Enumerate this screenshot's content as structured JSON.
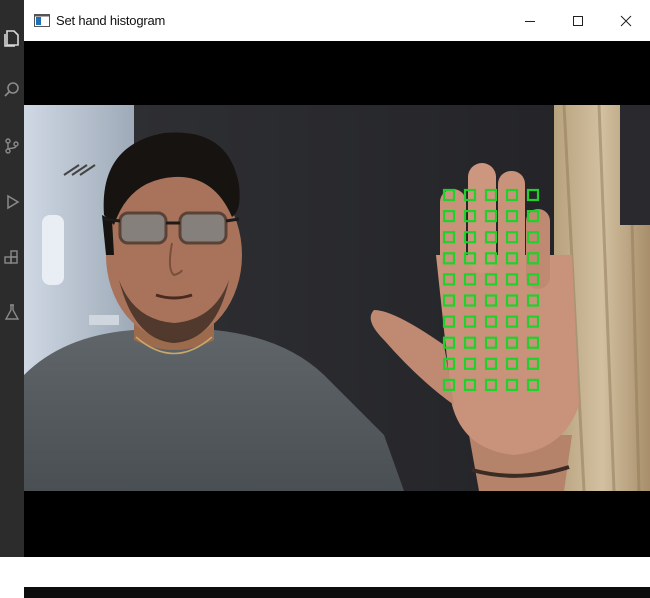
{
  "window": {
    "title": "Set hand histogram",
    "minimize_icon": "minimize-icon",
    "maximize_icon": "maximize-icon",
    "close_icon": "close-icon"
  },
  "activity_bar": {
    "icons": [
      "files-icon",
      "search-icon",
      "source-control-icon",
      "run-debug-icon",
      "extensions-icon",
      "testing-icon"
    ]
  },
  "camera_frame": {
    "sample_grid": {
      "rows": 10,
      "cols": 5,
      "color": "#1fd12a"
    }
  },
  "colors": {
    "window_bg": "#000000",
    "titlebar_bg": "#ffffff",
    "activity_bar_bg": "#2c2c2c",
    "grid_box": "#1fd12a"
  }
}
